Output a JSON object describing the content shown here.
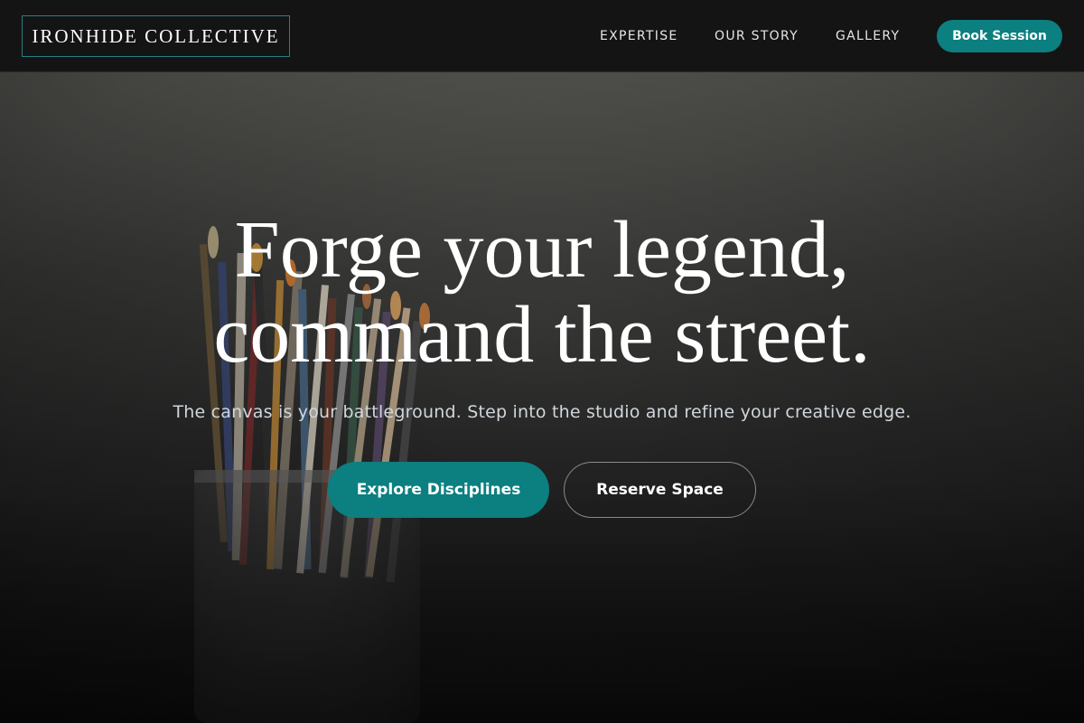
{
  "header": {
    "logo": "IRONHIDE COLLECTIVE",
    "nav": [
      "EXPERTISE",
      "OUR STORY",
      "GALLERY"
    ],
    "cta": "Book Session"
  },
  "hero": {
    "headline_line1": "Forge your legend,",
    "headline_line2": "command the street.",
    "subtitle": "The canvas is your battleground. Step into the studio and refine your creative edge.",
    "primary_button": "Explore Disciplines",
    "secondary_button": "Reserve Space",
    "background_image": "paintbrushes-in-jar"
  },
  "colors": {
    "accent": "#0c7f80",
    "header_bg": "#141414",
    "logo_border": "#2a7f83",
    "subtitle_text": "#cfd6dc"
  }
}
